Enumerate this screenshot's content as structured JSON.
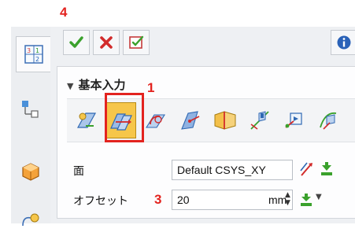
{
  "annotations": {
    "step_toolbar": "4",
    "step_icon": "1",
    "step_offset": "3"
  },
  "section": {
    "title": "基本入力",
    "collapse_glyph": "▼"
  },
  "form": {
    "face_label": "面",
    "face_value": "Default CSYS_XY",
    "offset_label": "オフセット",
    "offset_value": "20",
    "offset_unit": "mm",
    "spinner_glyph": "⌃⌄"
  },
  "colors": {
    "annotation_red": "#e3231f",
    "selected_yellow": "#f6c64a",
    "ok_green": "#3aa12c",
    "cancel_red": "#d22b2b"
  },
  "icons": {
    "toolbar": [
      "check-icon",
      "close-icon",
      "apply-icon",
      "info-icon"
    ],
    "sidebar": [
      "parameters-icon",
      "tree-icon",
      "part-icon",
      "shape-icon"
    ],
    "strip": [
      "point-plane-icon",
      "offset-plane-icon",
      "angle-plane-icon",
      "normal-plane-icon",
      "midplane-icon",
      "axis-plane-icon",
      "view-plane-icon",
      "curve-plane-icon"
    ]
  }
}
